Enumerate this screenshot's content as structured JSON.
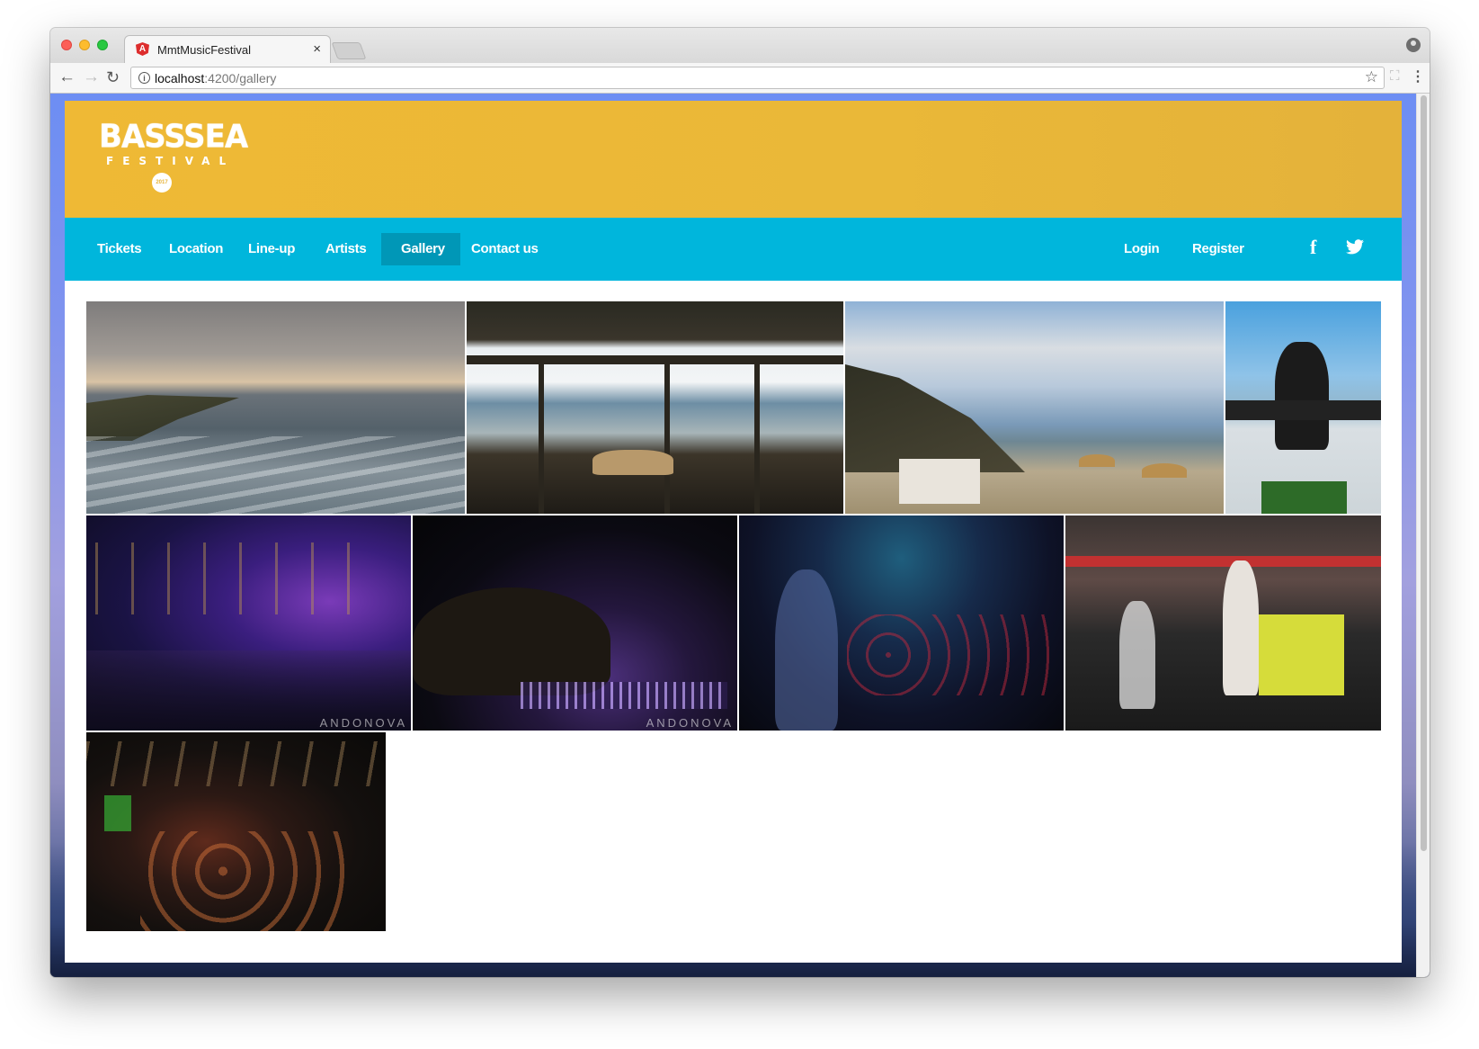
{
  "browser": {
    "tab_title": "MmtMusicFestival",
    "tab_close": "×",
    "url_host": "localhost",
    "url_rest": ":4200/gallery"
  },
  "site": {
    "logo": {
      "main": "BASSSEA",
      "sub": "FESTIVAL",
      "year": "2017"
    },
    "nav": {
      "left": [
        "Tickets",
        "Location",
        "Line-up",
        "Artists",
        "Gallery",
        "Contact us"
      ],
      "active": "Gallery",
      "right": [
        "Login",
        "Register"
      ],
      "facebook_glyph": "f",
      "twitter_glyph": "🐦"
    },
    "colors": {
      "banner": "#eab838",
      "navbar": "#00b6dc",
      "nav_active": "#0097b7"
    }
  },
  "gallery": {
    "photos": [
      {
        "name": "photo-sea-cliffs-clouds",
        "watermark": ""
      },
      {
        "name": "photo-beach-bar-roof",
        "watermark": ""
      },
      {
        "name": "photo-beach-umbrellas",
        "watermark": ""
      },
      {
        "name": "photo-dj-boat",
        "watermark": ""
      },
      {
        "name": "photo-night-party-purple",
        "watermark": "ANDONOVA"
      },
      {
        "name": "photo-night-party-aerial",
        "watermark": "ANDONOVA"
      },
      {
        "name": "photo-night-crowd-blue",
        "watermark": ""
      },
      {
        "name": "photo-stage-performer",
        "watermark": ""
      },
      {
        "name": "photo-crowd-bar-red",
        "watermark": ""
      }
    ]
  }
}
